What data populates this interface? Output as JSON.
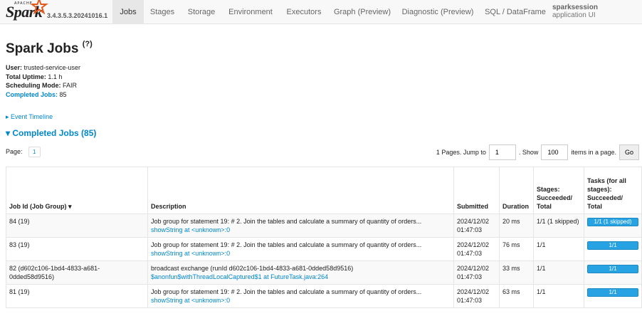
{
  "brand": {
    "apache": "APACHE",
    "logo": "Spark",
    "version": "3.4.3.5.3.20241016.1"
  },
  "nav": {
    "tabs": [
      {
        "label": "Jobs"
      },
      {
        "label": "Stages"
      },
      {
        "label": "Storage"
      },
      {
        "label": "Environment"
      },
      {
        "label": "Executors"
      },
      {
        "label": "Graph (Preview)"
      },
      {
        "label": "Diagnostic (Preview)"
      },
      {
        "label": "SQL / DataFrame"
      }
    ],
    "app_name": "sparksession",
    "app_suffix": "application UI"
  },
  "page": {
    "title": "Spark Jobs",
    "help": "(?)"
  },
  "summary": {
    "user_label": "User:",
    "user_value": "trusted-service-user",
    "uptime_label": "Total Uptime:",
    "uptime_value": "1.1 h",
    "mode_label": "Scheduling Mode:",
    "mode_value": "FAIR",
    "completed_label": "Completed Jobs:",
    "completed_value": "85"
  },
  "event_timeline": "Event Timeline",
  "completed_section": "Completed Jobs (85)",
  "pagination": {
    "page_label": "Page:",
    "page_value": "1",
    "pages_text": "1 Pages. Jump to",
    "jump_value": "1",
    "show_text": ". Show",
    "show_value": "100",
    "items_text": "items in a page.",
    "go_label": "Go"
  },
  "table": {
    "headers": {
      "job_id": "Job Id (Job Group) ▾",
      "description": "Description",
      "submitted": "Submitted",
      "duration": "Duration",
      "stages": "Stages: Succeeded/ Total",
      "tasks": "Tasks (for all stages): Succeeded/ Total"
    },
    "rows": [
      {
        "job_id": "84 (19)",
        "desc": "Job group for statement 19: # 2. Join the tables and calculate a summary of quantity of orders...",
        "link": "showString at <unknown>:0",
        "date": "2024/12/02",
        "time": "01:47:03",
        "duration": "20 ms",
        "stages": "1/1 (1 skipped)",
        "tasks": "1/1 (1 skipped)",
        "tasks_fraction": 1.0
      },
      {
        "job_id": "83 (19)",
        "desc": "Job group for statement 19: # 2. Join the tables and calculate a summary of quantity of orders...",
        "link": "showString at <unknown>:0",
        "date": "2024/12/02",
        "time": "01:47:03",
        "duration": "76 ms",
        "stages": "1/1",
        "tasks": "1/1",
        "tasks_fraction": 1.0
      },
      {
        "job_id": "82 (d602c106-1bd4-4833-a681-0dded58d9516)",
        "desc": "broadcast exchange (runId d602c106-1bd4-4833-a681-0dded58d9516)",
        "link": "$anonfun$withThreadLocalCaptured$1 at FutureTask.java:264",
        "date": "2024/12/02",
        "time": "01:47:03",
        "duration": "33 ms",
        "stages": "1/1",
        "tasks": "1/1",
        "tasks_fraction": 1.0
      },
      {
        "job_id": "81 (19)",
        "desc": "Job group for statement 19: # 2. Join the tables and calculate a summary of quantity of orders...",
        "link": "showString at <unknown>:0",
        "date": "2024/12/02",
        "time": "01:47:03",
        "duration": "63 ms",
        "stages": "1/1",
        "tasks": "1/1",
        "tasks_fraction": 1.0
      }
    ]
  },
  "colors": {
    "accent": "#0088cc",
    "progress": "#27a3e3"
  }
}
